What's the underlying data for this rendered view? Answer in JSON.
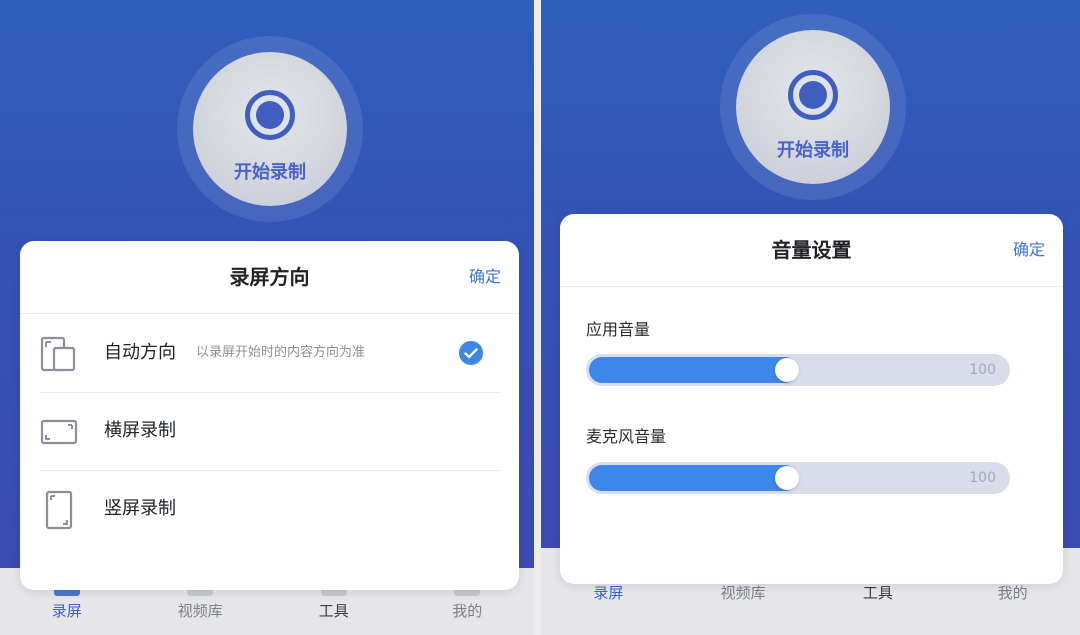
{
  "left_panel": {
    "record_button_label": "开始录制",
    "sheet": {
      "title": "录屏方向",
      "confirm_label": "确定",
      "options": [
        {
          "label": "自动方向",
          "description": "以录屏开始时的内容方向为准",
          "selected": true,
          "icon": "auto-orientation-icon"
        },
        {
          "label": "横屏录制",
          "description": "",
          "selected": false,
          "icon": "landscape-icon"
        },
        {
          "label": "竖屏录制",
          "description": "",
          "selected": false,
          "icon": "portrait-icon"
        }
      ]
    },
    "tabs": [
      {
        "label": "录屏",
        "active": true
      },
      {
        "label": "视频库",
        "active": false
      },
      {
        "label": "工具",
        "active": false
      },
      {
        "label": "我的",
        "active": false
      }
    ]
  },
  "right_panel": {
    "record_button_label": "开始录制",
    "sheet": {
      "title": "音量设置",
      "confirm_label": "确定",
      "sliders": [
        {
          "label": "应用音量",
          "value_percent": 50,
          "max_label": "100"
        },
        {
          "label": "麦克风音量",
          "value_percent": 50,
          "max_label": "100"
        }
      ]
    },
    "tabs": [
      {
        "label": "录屏",
        "active": true
      },
      {
        "label": "视频库",
        "active": false
      },
      {
        "label": "工具",
        "active": false
      },
      {
        "label": "我的",
        "active": false
      }
    ]
  },
  "colors": {
    "accent": "#3d86e8",
    "background_top": "#2f5fbd",
    "background_bottom": "#3b4bb4",
    "tab_active": "#3a63c8"
  }
}
